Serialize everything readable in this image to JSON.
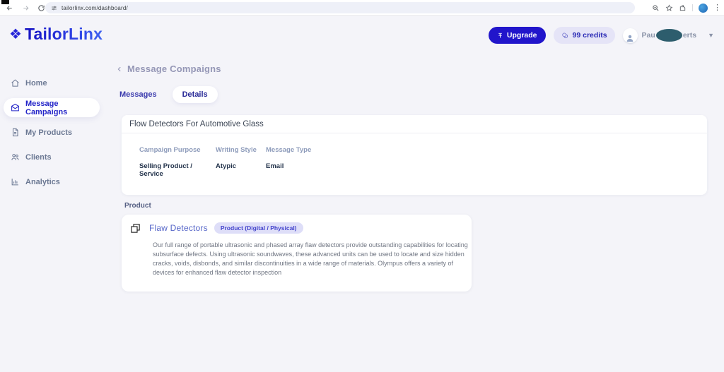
{
  "browser": {
    "url": "tailorlinx.com/dashboard/"
  },
  "header": {
    "logo_icon": "❖",
    "logo_text": "TailorLinx",
    "upgrade_label": "Upgrade",
    "credits_label": "99 credits",
    "user_name_left": "Pau",
    "user_name_right": "erts"
  },
  "sidebar": {
    "items": [
      {
        "label": "Home"
      },
      {
        "label": "Message Campaigns"
      },
      {
        "label": "My Products"
      },
      {
        "label": "Clients"
      },
      {
        "label": "Analytics"
      }
    ]
  },
  "main": {
    "page_title": "Message Compaigns",
    "tabs": [
      {
        "label": "Messages"
      },
      {
        "label": "Details"
      }
    ],
    "campaign_card": {
      "title": "Flow Detectors For Automotive Glass",
      "fields": [
        {
          "label": "Campaign Purpose",
          "value": "Selling Product / Service"
        },
        {
          "label": "Writing Style",
          "value": "Atypic"
        },
        {
          "label": "Message Type",
          "value": "Email"
        }
      ]
    },
    "product_section": {
      "label": "Product",
      "card": {
        "title": "Flaw Detectors",
        "badge": "Product (Digital / Physical)",
        "description": "Our full range of portable ultrasonic and phased array flaw detectors provide outstanding capabilities for locating subsurface defects. Using ultrasonic soundwaves, these advanced units can be used to locate and size hidden cracks, voids, disbonds, and similar discontinuities in a wide range of materials. Olympus offers a variety of devices for enhanced flaw detector inspection"
      }
    }
  },
  "colors": {
    "accent": "#2115cb",
    "app_background": "#f4f4f9",
    "card_background": "#ffffff",
    "redaction": "#2d5d6d"
  }
}
